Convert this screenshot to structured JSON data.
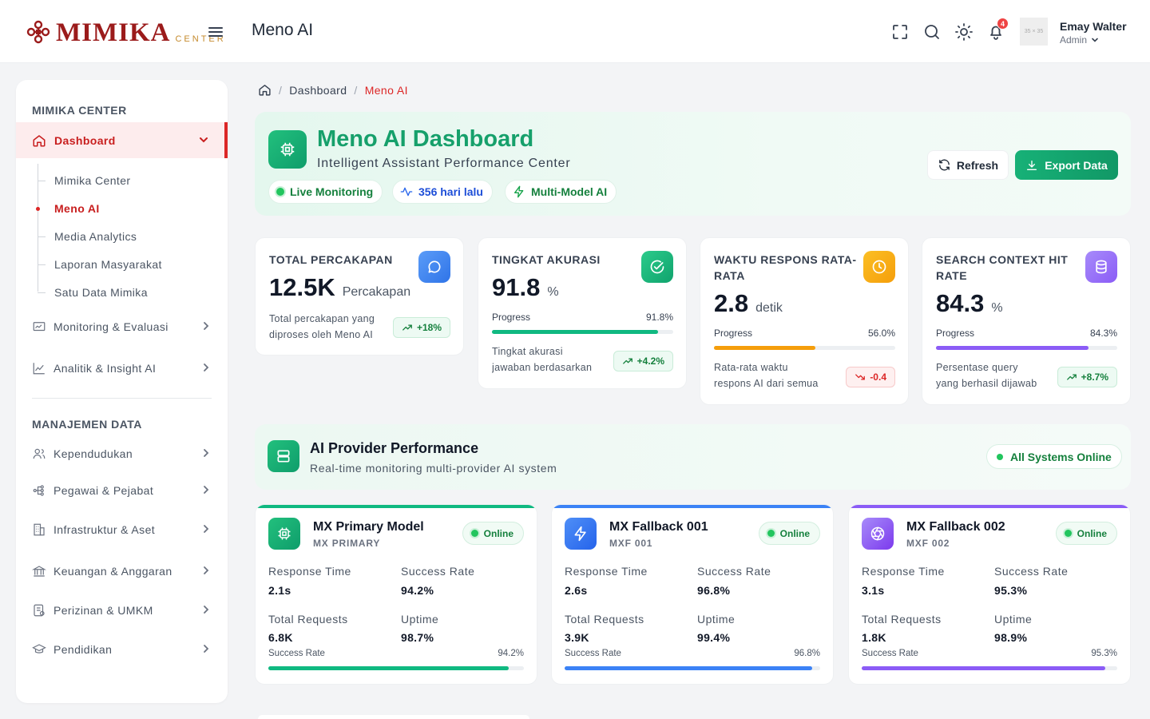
{
  "header": {
    "brand": "MIMIKA",
    "brand_sub": "CENTER",
    "page_title": "Meno AI",
    "notif_count": "4",
    "avatar_placeholder": "35 × 35",
    "user_name": "Emay Walter",
    "user_role": "Admin"
  },
  "sidebar": {
    "section1": "MIMIKA CENTER",
    "active": "Dashboard",
    "subitems": [
      "Mimika Center",
      "Meno AI",
      "Media Analytics",
      "Laporan Masyarakat",
      "Satu Data Mimika"
    ],
    "items1": [
      "Monitoring & Evaluasi",
      "Analitik & Insight AI"
    ],
    "section2": "MANAJEMEN DATA",
    "items2": [
      "Kependudukan",
      "Pegawai & Pejabat",
      "Infrastruktur & Aset",
      "Keuangan & Anggaran",
      "Perizinan & UMKM",
      "Pendidikan"
    ]
  },
  "breadcrumb": {
    "home_icon": "home-icon",
    "level1": "Dashboard",
    "sep": "/",
    "current": "Meno AI"
  },
  "hero": {
    "title": "Meno AI Dashboard",
    "subtitle": "Intelligent Assistant Performance Center",
    "pill_live": "Live Monitoring",
    "pill_days": "356 hari lalu",
    "pill_model": "Multi-Model AI",
    "refresh": "Refresh",
    "export": "Export Data"
  },
  "stats": [
    {
      "title": "TOTAL PERCAKAPAN",
      "value": "12.5K",
      "unit": "Percakapan",
      "desc1": "Total percakapan yang",
      "desc2": "diproses oleh Meno AI",
      "trend": "+18%",
      "color": "#3b82f6"
    },
    {
      "title": "TINGKAT AKURASI",
      "value": "91.8",
      "unit": "%",
      "progress_label": "Progress",
      "progress_text": "91.8%",
      "progress": 91.8,
      "desc1": "Tingkat akurasi",
      "desc2": "jawaban berdasarkan",
      "trend": "+4.2%",
      "color": "#10b981"
    },
    {
      "title": "WAKTU RESPONS RATA-RATA",
      "value": "2.8",
      "unit": "detik",
      "progress_label": "Progress",
      "progress_text": "56.0%",
      "progress": 56.0,
      "desc1": "Rata-rata waktu",
      "desc2": "respons AI dari semua",
      "trend": "-0.4",
      "color": "#f59e0b"
    },
    {
      "title": "SEARCH CONTEXT HIT RATE",
      "value": "84.3",
      "unit": "%",
      "progress_label": "Progress",
      "progress_text": "84.3%",
      "progress": 84.3,
      "desc1": "Persentase query",
      "desc2": "yang berhasil dijawab",
      "trend": "+8.7%",
      "color": "#8b5cf6"
    }
  ],
  "providers_header": {
    "title": "AI Provider Performance",
    "subtitle": "Real-time monitoring multi-provider AI system",
    "status": "All Systems Online"
  },
  "providers": [
    {
      "name": "MX Primary Model",
      "code": "MX PRIMARY",
      "status": "Online",
      "resp_label": "Response Time",
      "resp": "2.1s",
      "succ_label": "Success Rate",
      "succ": "94.2%",
      "req_label": "Total Requests",
      "req": "6.8K",
      "up_label": "Uptime",
      "up": "98.7%",
      "bar_label": "Success Rate",
      "bar_text": "94.2%",
      "bar": 94.2,
      "color": "#10b981"
    },
    {
      "name": "MX Fallback 001",
      "code": "MXF 001",
      "status": "Online",
      "resp_label": "Response Time",
      "resp": "2.6s",
      "succ_label": "Success Rate",
      "succ": "96.8%",
      "req_label": "Total Requests",
      "req": "3.9K",
      "up_label": "Uptime",
      "up": "99.4%",
      "bar_label": "Success Rate",
      "bar_text": "96.8%",
      "bar": 96.8,
      "color": "#3b82f6"
    },
    {
      "name": "MX Fallback 002",
      "code": "MXF 002",
      "status": "Online",
      "resp_label": "Response Time",
      "resp": "3.1s",
      "succ_label": "Success Rate",
      "succ": "95.3%",
      "req_label": "Total Requests",
      "req": "1.8K",
      "up_label": "Uptime",
      "up": "98.9%",
      "bar_label": "Success Rate",
      "bar_text": "95.3%",
      "bar": 95.3,
      "color": "#8b5cf6"
    }
  ]
}
